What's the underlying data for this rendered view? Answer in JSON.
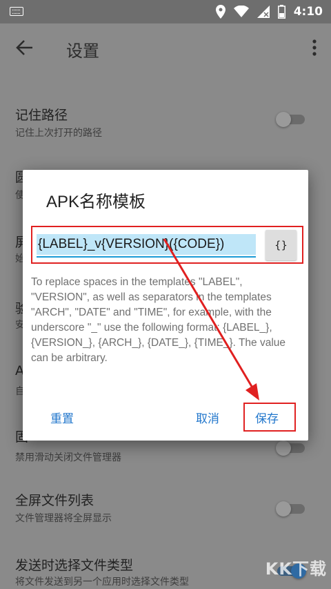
{
  "status_bar": {
    "time": "4:10"
  },
  "app_bar": {
    "title": "设置"
  },
  "settings": [
    {
      "title": "记住路径",
      "subtitle": "记住上次打开的路径",
      "on": false
    },
    {
      "title": "圆",
      "subtitle": "使",
      "on": false
    },
    {
      "title": "屏",
      "subtitle": "始",
      "on": false
    },
    {
      "title": "验",
      "subtitle": "安",
      "on": true
    },
    {
      "title": "A",
      "subtitle": "自",
      "on": false
    },
    {
      "title": "固",
      "subtitle": "禁用滑动关闭文件管理器",
      "on": false
    },
    {
      "title": "全屏文件列表",
      "subtitle": "文件管理器将全屏显示",
      "on": false
    },
    {
      "title": "发送时选择文件类型",
      "subtitle": "将文件发送到另一个应用时选择文件类型",
      "on": true
    }
  ],
  "dialog": {
    "title": "APK名称模板",
    "template_value": "{LABEL}_v{VERSION}({CODE})",
    "insert_button": "{}",
    "help_text": "To replace spaces in the templates \"LABEL\", \"VERSION\", as well as separators in the templates \"ARCH\", \"DATE\" and \"TIME\", for example, with the underscore \"_\" use the following format: {LABEL_}, {VERSION_}, {ARCH_}, {DATE_}, {TIME_}. The value can be arbitrary.",
    "reset_label": "重置",
    "cancel_label": "取消",
    "save_label": "保存"
  },
  "watermark": "KK下载",
  "colors": {
    "accent": "#2277cc",
    "highlight": "#e02020",
    "selection": "#bfe6f8"
  }
}
